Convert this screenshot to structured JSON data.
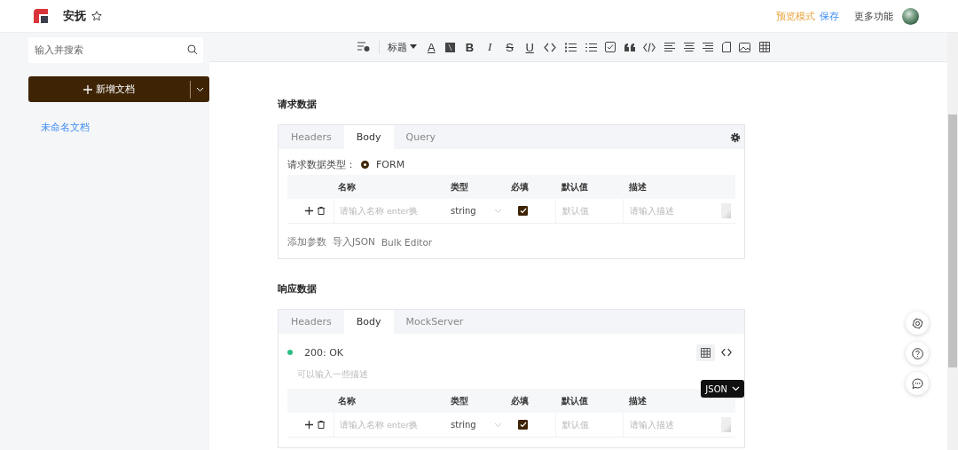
{
  "header": {
    "title": "安抚",
    "starred": false,
    "preview_label": "预览模式",
    "save_label": "保存",
    "more_label": "更多功能"
  },
  "sidebar": {
    "search": {
      "placeholder": "输入并搜索"
    },
    "new_button": "新增文档",
    "items": [
      {
        "label": "未命名文档",
        "selected": true
      }
    ]
  },
  "toolbar": [
    {
      "kind": "format-clear"
    },
    {
      "kind": "heading",
      "label": "标题"
    },
    {
      "kind": "font-color",
      "label": "A"
    },
    {
      "kind": "background-color"
    },
    {
      "kind": "bold",
      "label": "B"
    },
    {
      "kind": "italic",
      "label": "I"
    },
    {
      "kind": "strike",
      "label": "S"
    },
    {
      "kind": "underline",
      "label": "U"
    },
    {
      "kind": "code"
    },
    {
      "kind": "bullet-list"
    },
    {
      "kind": "ordered-list"
    },
    {
      "kind": "task"
    },
    {
      "kind": "quote"
    },
    {
      "kind": "code-block"
    },
    {
      "kind": "align-left"
    },
    {
      "kind": "align-center"
    },
    {
      "kind": "align-right"
    },
    {
      "kind": "page"
    },
    {
      "kind": "image"
    },
    {
      "kind": "table"
    }
  ],
  "request": {
    "title": "请求数据",
    "tabs": [
      {
        "label": "Headers",
        "selected": false
      },
      {
        "label": "Body",
        "selected": true
      },
      {
        "label": "Query",
        "selected": false
      }
    ],
    "body_type_label": "请求数据类型：",
    "body_type": {
      "label": "FORM",
      "selected": true
    },
    "columns": [
      "名称",
      "类型",
      "必填",
      "默认值",
      "描述"
    ],
    "rows": [
      {
        "name_placeholder": "请输入名称 enter换",
        "type": "string",
        "required": true,
        "default_placeholder": "默认值",
        "desc_placeholder": "请输入描述"
      }
    ],
    "actions": [
      "添加参数",
      "导入JSON",
      "Bulk Editor"
    ]
  },
  "response": {
    "title": "响应数据",
    "tabs": [
      {
        "label": "Headers",
        "selected": false
      },
      {
        "label": "Body",
        "selected": true
      },
      {
        "label": "MockServer",
        "selected": false
      }
    ],
    "status": {
      "label": "200: OK",
      "color": "#2ebd85"
    },
    "views": [
      {
        "kind": "table",
        "selected": true
      },
      {
        "kind": "code",
        "selected": false
      }
    ],
    "description_placeholder": "可以输入一些描述",
    "format": "JSON",
    "columns": [
      "名称",
      "类型",
      "必填",
      "默认值",
      "描述"
    ],
    "rows": [
      {
        "name_placeholder": "请输入名称 enter换",
        "type": "string",
        "required": true,
        "default_placeholder": "默认值",
        "desc_placeholder": "请输入描述"
      }
    ]
  },
  "float_buttons": [
    {
      "kind": "settings"
    },
    {
      "kind": "help"
    },
    {
      "kind": "chat"
    }
  ]
}
